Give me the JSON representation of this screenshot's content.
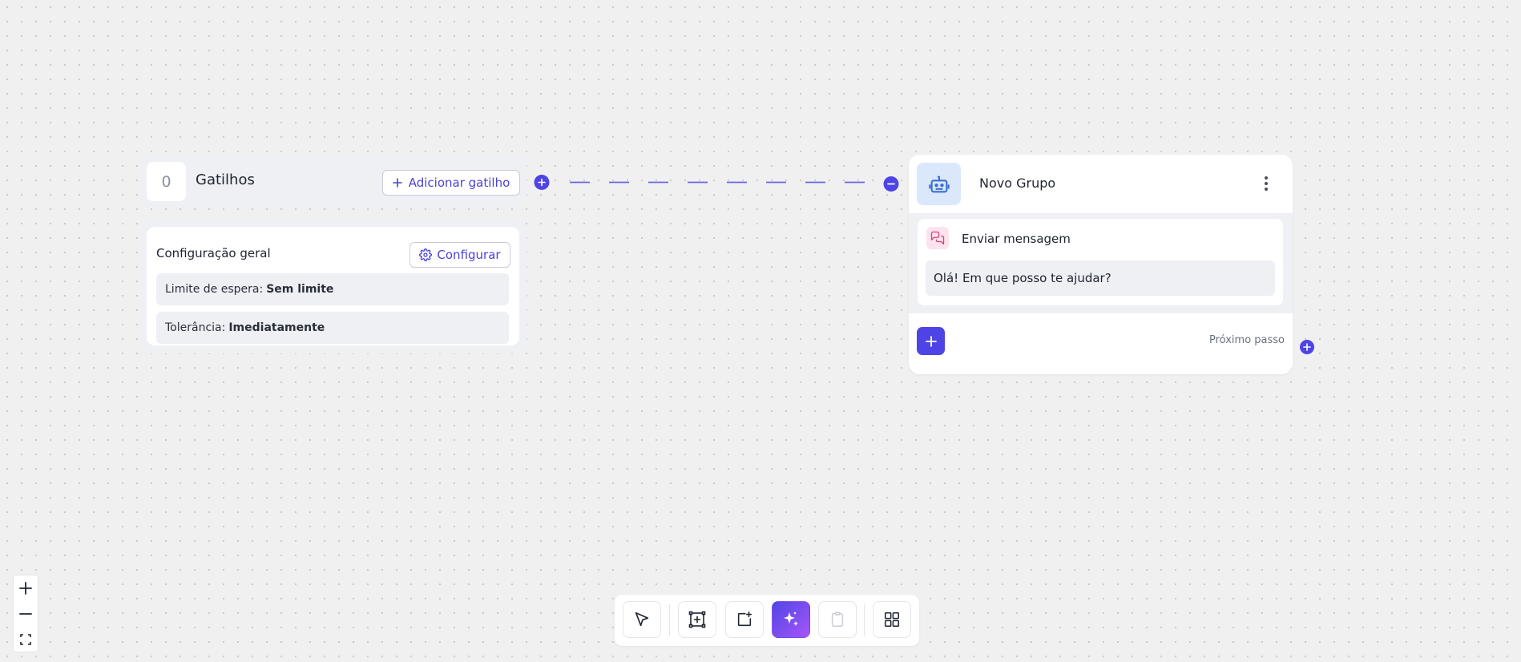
{
  "trigger_header": {
    "count": "0",
    "title": "Gatilhos",
    "add_button_label": "Adicionar gatilho"
  },
  "config": {
    "title": "Configuração geral",
    "configure_label": "Configurar",
    "wait_limit_label": "Limite de espera:",
    "wait_limit_value": "Sem limite",
    "tolerance_label": "Tolerância:",
    "tolerance_value": "Imediatamente"
  },
  "group": {
    "title": "Novo Grupo",
    "message_title": "Enviar mensagem",
    "message_text": "Olá! Em que posso te ajudar?",
    "next_step_label": "Próximo passo"
  },
  "colors": {
    "accent": "#4e44e5",
    "canvas": "#f0f0f0",
    "card_gray": "#eef0f4"
  },
  "icons": {
    "zoom": [
      "plus-icon",
      "minus-icon",
      "fit-view-icon"
    ],
    "toolbar": [
      "pointer-icon",
      "add-frame-icon",
      "add-note-icon",
      "sparkles-icon",
      "clipboard-icon",
      "grid-icon"
    ]
  }
}
